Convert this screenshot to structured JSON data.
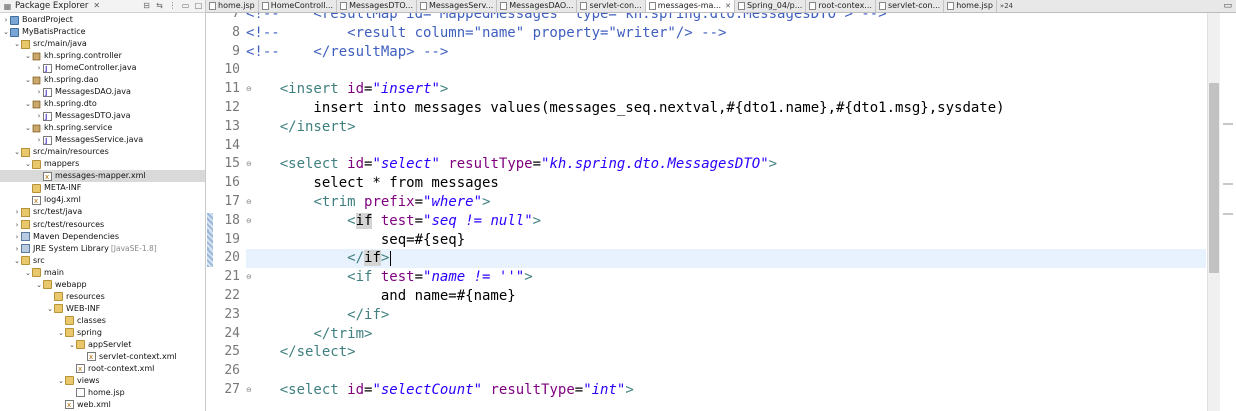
{
  "explorer": {
    "title": "Package Explorer",
    "items": [
      {
        "label": "BoardProject",
        "depth": 0,
        "twisty": "›",
        "icon": "project-icon",
        "iconClass": "ico-project"
      },
      {
        "label": "MyBatisPractice",
        "depth": 0,
        "twisty": "⌄",
        "icon": "project-icon",
        "iconClass": "ico-project"
      },
      {
        "label": "src/main/java",
        "depth": 1,
        "twisty": "⌄",
        "icon": "source-folder-icon",
        "iconClass": "ico-srcfolder"
      },
      {
        "label": "kh.spring.controller",
        "depth": 2,
        "twisty": "⌄",
        "icon": "package-icon",
        "iconClass": "ico-package"
      },
      {
        "label": "HomeController.java",
        "depth": 3,
        "twisty": "›",
        "icon": "java-file-icon",
        "iconClass": "ico-java"
      },
      {
        "label": "kh.spring.dao",
        "depth": 2,
        "twisty": "⌄",
        "icon": "package-icon",
        "iconClass": "ico-package"
      },
      {
        "label": "MessagesDAO.java",
        "depth": 3,
        "twisty": "›",
        "icon": "java-file-icon",
        "iconClass": "ico-java"
      },
      {
        "label": "kh.spring.dto",
        "depth": 2,
        "twisty": "⌄",
        "icon": "package-icon",
        "iconClass": "ico-package"
      },
      {
        "label": "MessagesDTO.java",
        "depth": 3,
        "twisty": "›",
        "icon": "java-file-icon",
        "iconClass": "ico-java"
      },
      {
        "label": "kh.spring.service",
        "depth": 2,
        "twisty": "⌄",
        "icon": "package-icon",
        "iconClass": "ico-package"
      },
      {
        "label": "MessagesService.java",
        "depth": 3,
        "twisty": "›",
        "icon": "java-file-icon",
        "iconClass": "ico-java"
      },
      {
        "label": "src/main/resources",
        "depth": 1,
        "twisty": "⌄",
        "icon": "source-folder-icon",
        "iconClass": "ico-srcfolder"
      },
      {
        "label": "mappers",
        "depth": 2,
        "twisty": "⌄",
        "icon": "folder-icon",
        "iconClass": "ico-folder"
      },
      {
        "label": "messages-mapper.xml",
        "depth": 3,
        "twisty": "",
        "icon": "xml-file-icon",
        "iconClass": "ico-xml",
        "selected": true
      },
      {
        "label": "META-INF",
        "depth": 2,
        "twisty": "",
        "icon": "folder-icon",
        "iconClass": "ico-folder"
      },
      {
        "label": "log4j.xml",
        "depth": 2,
        "twisty": "",
        "icon": "xml-file-icon",
        "iconClass": "ico-xml"
      },
      {
        "label": "src/test/java",
        "depth": 1,
        "twisty": "›",
        "icon": "source-folder-icon",
        "iconClass": "ico-srcfolder"
      },
      {
        "label": "src/test/resources",
        "depth": 1,
        "twisty": "›",
        "icon": "source-folder-icon",
        "iconClass": "ico-srcfolder"
      },
      {
        "label": "Maven Dependencies",
        "depth": 1,
        "twisty": "›",
        "icon": "library-icon",
        "iconClass": "ico-lib"
      },
      {
        "label": "JRE System Library",
        "depth": 1,
        "twisty": "›",
        "icon": "library-icon",
        "iconClass": "ico-lib",
        "decoration": "[JavaSE-1.8]"
      },
      {
        "label": "src",
        "depth": 1,
        "twisty": "⌄",
        "icon": "folder-icon",
        "iconClass": "ico-folder"
      },
      {
        "label": "main",
        "depth": 2,
        "twisty": "⌄",
        "icon": "folder-icon",
        "iconClass": "ico-folder"
      },
      {
        "label": "webapp",
        "depth": 3,
        "twisty": "⌄",
        "icon": "folder-icon",
        "iconClass": "ico-folder"
      },
      {
        "label": "resources",
        "depth": 4,
        "twisty": "",
        "icon": "folder-icon",
        "iconClass": "ico-folder"
      },
      {
        "label": "WEB-INF",
        "depth": 4,
        "twisty": "⌄",
        "icon": "folder-icon",
        "iconClass": "ico-folder"
      },
      {
        "label": "classes",
        "depth": 5,
        "twisty": "",
        "icon": "folder-icon",
        "iconClass": "ico-folder"
      },
      {
        "label": "spring",
        "depth": 5,
        "twisty": "⌄",
        "icon": "folder-icon",
        "iconClass": "ico-folder"
      },
      {
        "label": "appServlet",
        "depth": 6,
        "twisty": "⌄",
        "icon": "folder-icon",
        "iconClass": "ico-folder"
      },
      {
        "label": "servlet-context.xml",
        "depth": 7,
        "twisty": "",
        "icon": "xml-file-icon",
        "iconClass": "ico-xml"
      },
      {
        "label": "root-context.xml",
        "depth": 6,
        "twisty": "",
        "icon": "xml-file-icon",
        "iconClass": "ico-xml"
      },
      {
        "label": "views",
        "depth": 5,
        "twisty": "⌄",
        "icon": "folder-icon",
        "iconClass": "ico-folder"
      },
      {
        "label": "home.jsp",
        "depth": 6,
        "twisty": "",
        "icon": "jsp-file-icon",
        "iconClass": "ico-jsp"
      },
      {
        "label": "web.xml",
        "depth": 5,
        "twisty": "",
        "icon": "xml-file-icon",
        "iconClass": "ico-xml"
      }
    ]
  },
  "tabs": [
    {
      "label": "home.jsp"
    },
    {
      "label": "HomeControll..."
    },
    {
      "label": "MessagesDTO..."
    },
    {
      "label": "MessagesServ..."
    },
    {
      "label": "MessagesDAO..."
    },
    {
      "label": "servlet-con..."
    },
    {
      "label": "messages-ma...",
      "active": true
    },
    {
      "label": "Spring_04/p..."
    },
    {
      "label": "root-contex..."
    },
    {
      "label": "servlet-con..."
    },
    {
      "label": "home.jsp"
    }
  ],
  "tab_overflow": "»24",
  "editor": {
    "lines": [
      {
        "n": "7",
        "fold": "",
        "tokens": [
          [
            "cm",
            "<!--    <resultMap id=\"MappedMessages\" type=\"kh.spring.dto.MessagesDTO\"> -->"
          ]
        ]
      },
      {
        "n": "8",
        "fold": "",
        "tokens": [
          [
            "cm",
            "<!--        <result column=\"name\" property=\"writer\"/> -->"
          ]
        ]
      },
      {
        "n": "9",
        "fold": "",
        "tokens": [
          [
            "cm",
            "<!--    </resultMap> -->"
          ]
        ]
      },
      {
        "n": "10",
        "fold": "",
        "tokens": []
      },
      {
        "n": "11",
        "fold": "⊖",
        "tokens": [
          [
            "",
            "    "
          ],
          [
            "tg",
            "<insert "
          ],
          [
            "at",
            "id"
          ],
          [
            "",
            "="
          ],
          [
            "av",
            "\"insert\""
          ],
          [
            "tg",
            ">"
          ]
        ]
      },
      {
        "n": "12",
        "fold": "",
        "tokens": [
          [
            "",
            "        insert into messages values(messages_seq.nextval,#{dto1.name},#{dto1.msg},sysdate)"
          ]
        ]
      },
      {
        "n": "13",
        "fold": "",
        "tokens": [
          [
            "",
            "    "
          ],
          [
            "tg",
            "</insert>"
          ]
        ]
      },
      {
        "n": "14",
        "fold": "",
        "tokens": []
      },
      {
        "n": "15",
        "fold": "⊖",
        "tokens": [
          [
            "",
            "    "
          ],
          [
            "tg",
            "<select "
          ],
          [
            "at",
            "id"
          ],
          [
            "",
            "="
          ],
          [
            "av",
            "\"select\""
          ],
          [
            "",
            ""
          ],
          [
            "at",
            " resultType"
          ],
          [
            "",
            "="
          ],
          [
            "av",
            "\"kh.spring.dto.MessagesDTO\""
          ],
          [
            "tg",
            ">"
          ]
        ]
      },
      {
        "n": "16",
        "fold": "",
        "tokens": [
          [
            "",
            "        select * from messages"
          ]
        ]
      },
      {
        "n": "17",
        "fold": "⊖",
        "tokens": [
          [
            "",
            "        "
          ],
          [
            "tg",
            "<trim "
          ],
          [
            "at",
            "prefix"
          ],
          [
            "",
            "="
          ],
          [
            "av",
            "\"where\""
          ],
          [
            "tg",
            ">"
          ]
        ]
      },
      {
        "n": "18",
        "fold": "⊖",
        "tokens": [
          [
            "",
            "            "
          ],
          [
            "tg",
            "<"
          ],
          [
            "hl",
            "if"
          ],
          [
            "at",
            " test"
          ],
          [
            "",
            "="
          ],
          [
            "av",
            "\"seq != null\""
          ],
          [
            "tg",
            ">"
          ]
        ]
      },
      {
        "n": "19",
        "fold": "",
        "tokens": [
          [
            "",
            "                seq=#{seq}"
          ]
        ]
      },
      {
        "n": "20",
        "fold": "",
        "current": true,
        "tokens": [
          [
            "",
            "            "
          ],
          [
            "tg",
            "</"
          ],
          [
            "hl",
            "if"
          ],
          [
            "tg",
            ">"
          ]
        ]
      },
      {
        "n": "21",
        "fold": "⊖",
        "tokens": [
          [
            "",
            "            "
          ],
          [
            "tg",
            "<if "
          ],
          [
            "at",
            "test"
          ],
          [
            "",
            "="
          ],
          [
            "av",
            "\"name != ''\""
          ],
          [
            "tg",
            ">"
          ]
        ]
      },
      {
        "n": "22",
        "fold": "",
        "tokens": [
          [
            "",
            "                and name=#{name}"
          ]
        ]
      },
      {
        "n": "23",
        "fold": "",
        "tokens": [
          [
            "",
            "            "
          ],
          [
            "tg",
            "</if>"
          ]
        ]
      },
      {
        "n": "24",
        "fold": "",
        "tokens": [
          [
            "",
            "        "
          ],
          [
            "tg",
            "</trim>"
          ]
        ]
      },
      {
        "n": "25",
        "fold": "",
        "tokens": [
          [
            "",
            "    "
          ],
          [
            "tg",
            "</select>"
          ]
        ]
      },
      {
        "n": "26",
        "fold": "",
        "tokens": []
      },
      {
        "n": "27",
        "fold": "⊖",
        "tokens": [
          [
            "",
            "    "
          ],
          [
            "tg",
            "<select "
          ],
          [
            "at",
            "id"
          ],
          [
            "",
            "="
          ],
          [
            "av",
            "\"selectCount\""
          ],
          [
            "at",
            " resultType"
          ],
          [
            "",
            "="
          ],
          [
            "av",
            "\"int\""
          ],
          [
            "tg",
            ">"
          ]
        ]
      }
    ]
  }
}
